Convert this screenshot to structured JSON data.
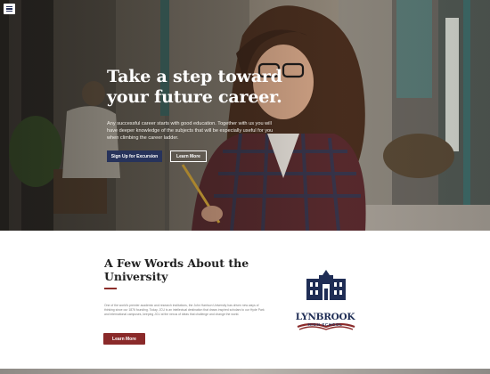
{
  "nav": {
    "menu_icon": "hamburger-menu-icon"
  },
  "hero": {
    "title": "Take a step toward your future career.",
    "description": "Any successful career starts with good education. Together with us you will have deeper knowledge of the subjects that will be especially useful for you when climbing the career ladder.",
    "primary_button": "Sign Up for Excursion",
    "secondary_button": "Learn More"
  },
  "about": {
    "title": "A Few Words About the University",
    "text": "One of the world's premier academic and research institutions, the John Harrison University has driven new ways of thinking since our 1876 founding. Today, JCU is an intellectual destination that draws inspired scholars to our Hyde Park and international campuses, keeping JCU at the nexus of ideas that challenge and change the world.",
    "button": "Learn More"
  },
  "logo": {
    "name": "LYNBROOK",
    "subtitle": "HIGH SCHOOL",
    "icon": "school-building-book-icon"
  },
  "colors": {
    "navy": "#27335b",
    "maroon": "#8a2a2a",
    "white": "#ffffff"
  }
}
